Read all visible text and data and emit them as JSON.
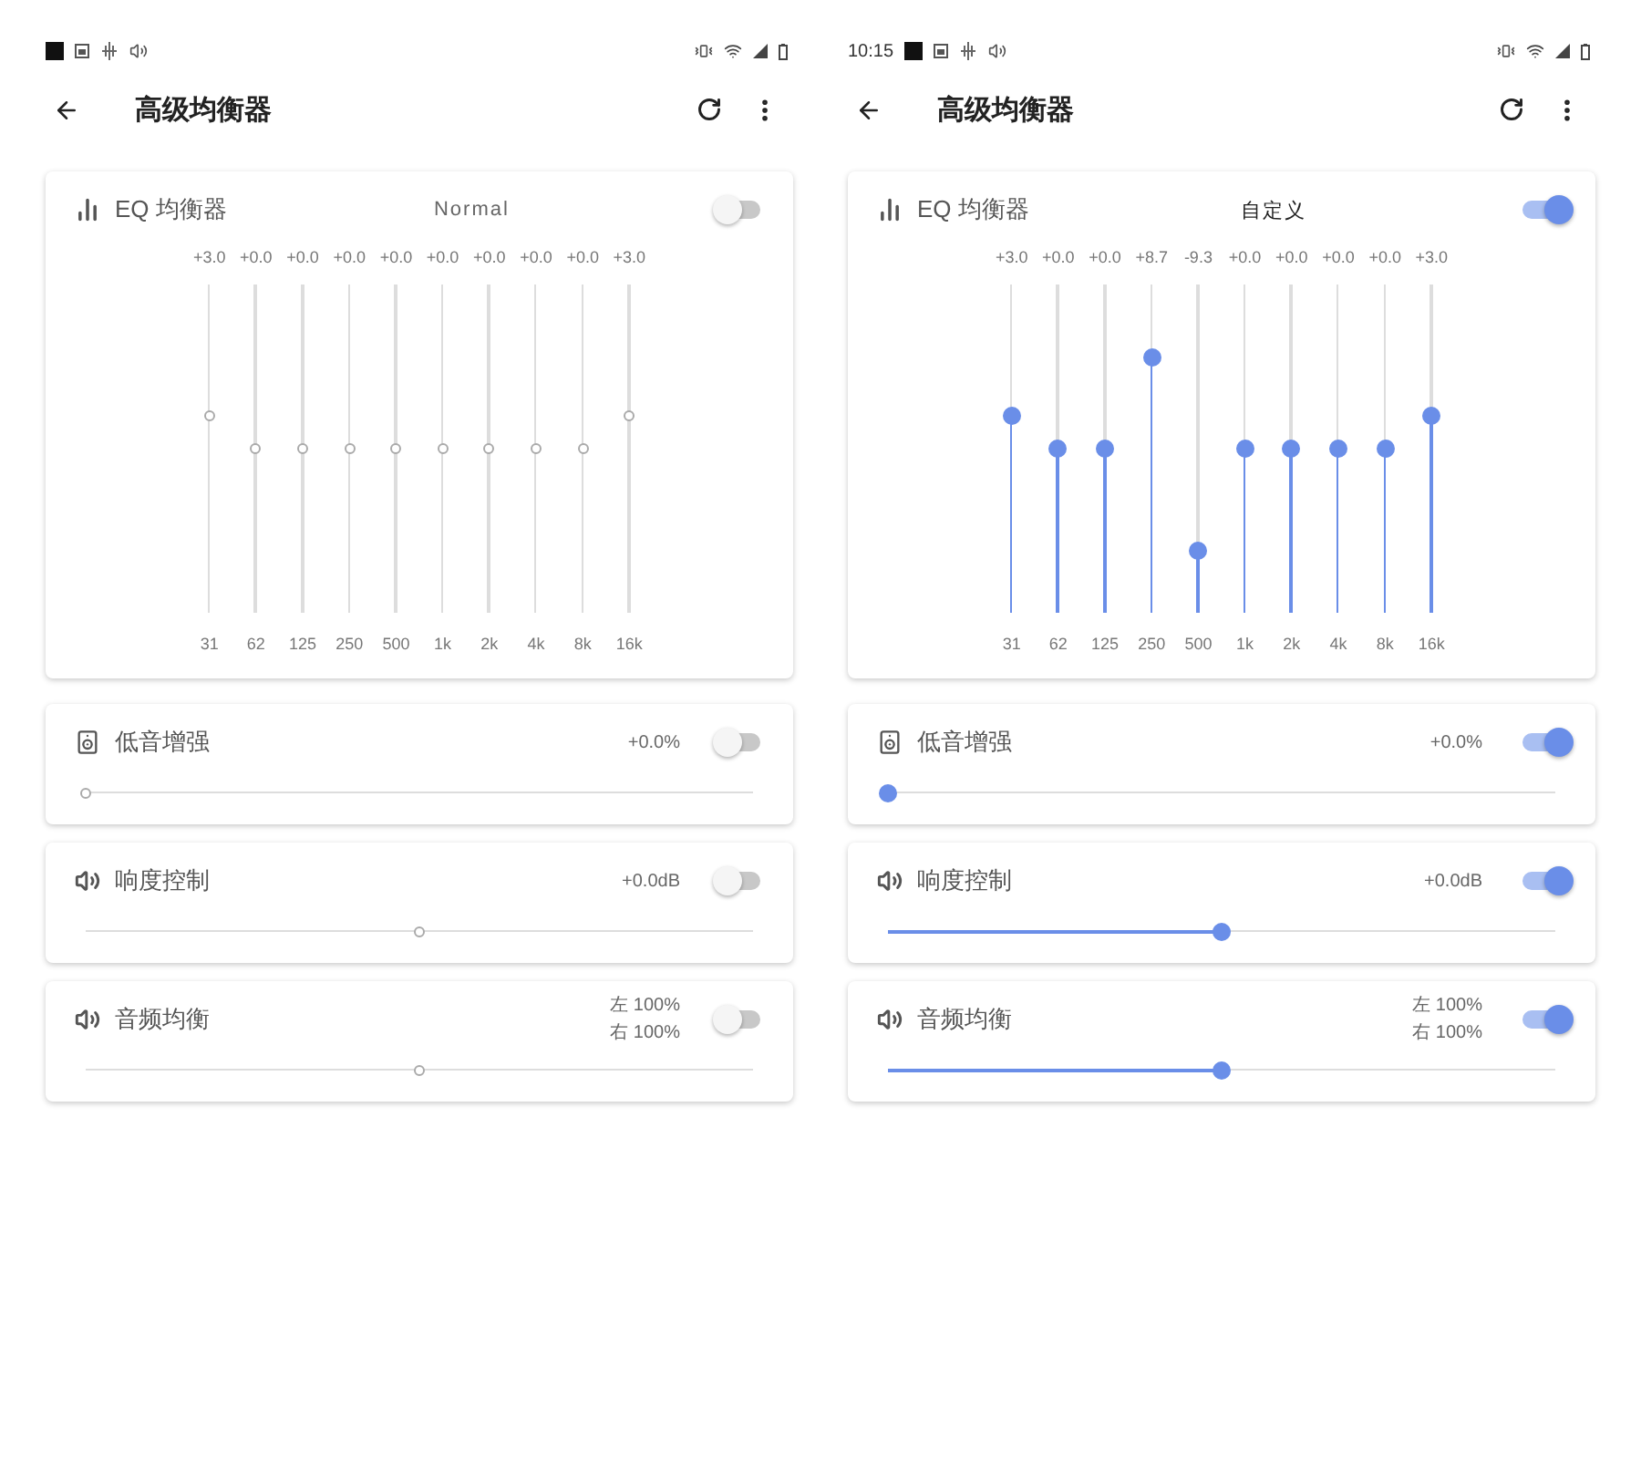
{
  "screens": [
    {
      "toolbar": {
        "title": "高级均衡器"
      },
      "eq": {
        "title": "EQ 均衡器",
        "preset": "Normal",
        "on": false,
        "bands": [
          {
            "gain": "+3.0",
            "freq": "31",
            "level": 0.6
          },
          {
            "gain": "+0.0",
            "freq": "62",
            "level": 0.5
          },
          {
            "gain": "+0.0",
            "freq": "125",
            "level": 0.5
          },
          {
            "gain": "+0.0",
            "freq": "250",
            "level": 0.5
          },
          {
            "gain": "+0.0",
            "freq": "500",
            "level": 0.5
          },
          {
            "gain": "+0.0",
            "freq": "1k",
            "level": 0.5
          },
          {
            "gain": "+0.0",
            "freq": "2k",
            "level": 0.5
          },
          {
            "gain": "+0.0",
            "freq": "4k",
            "level": 0.5
          },
          {
            "gain": "+0.0",
            "freq": "8k",
            "level": 0.5
          },
          {
            "gain": "+3.0",
            "freq": "16k",
            "level": 0.6
          }
        ]
      },
      "effects": [
        {
          "kind": "bass",
          "title": "低音增强",
          "readings": [
            "+0.0%"
          ],
          "on": false,
          "level": 0
        },
        {
          "kind": "loudness",
          "title": "响度控制",
          "readings": [
            "+0.0dB"
          ],
          "on": false,
          "level": 0.5
        },
        {
          "kind": "balance",
          "title": "音频均衡",
          "readings": [
            "左 100%",
            "右 100%"
          ],
          "on": false,
          "level": 0.5
        }
      ]
    },
    {
      "status_bar": {
        "time": "10:15"
      },
      "toolbar": {
        "title": "高级均衡器"
      },
      "eq": {
        "title": "EQ 均衡器",
        "preset": "自定义",
        "on": true,
        "bands": [
          {
            "gain": "+3.0",
            "freq": "31",
            "level": 0.6
          },
          {
            "gain": "+0.0",
            "freq": "62",
            "level": 0.5
          },
          {
            "gain": "+0.0",
            "freq": "125",
            "level": 0.5
          },
          {
            "gain": "+8.7",
            "freq": "250",
            "level": 0.78
          },
          {
            "gain": "-9.3",
            "freq": "500",
            "level": 0.19
          },
          {
            "gain": "+0.0",
            "freq": "1k",
            "level": 0.5
          },
          {
            "gain": "+0.0",
            "freq": "2k",
            "level": 0.5
          },
          {
            "gain": "+0.0",
            "freq": "4k",
            "level": 0.5
          },
          {
            "gain": "+0.0",
            "freq": "8k",
            "level": 0.5
          },
          {
            "gain": "+3.0",
            "freq": "16k",
            "level": 0.6
          }
        ]
      },
      "effects": [
        {
          "kind": "bass",
          "title": "低音增强",
          "readings": [
            "+0.0%"
          ],
          "on": true,
          "level": 0
        },
        {
          "kind": "loudness",
          "title": "响度控制",
          "readings": [
            "+0.0dB"
          ],
          "on": true,
          "level": 0.5
        },
        {
          "kind": "balance",
          "title": "音频均衡",
          "readings": [
            "左 100%",
            "右 100%"
          ],
          "on": true,
          "level": 0.5
        }
      ]
    }
  ]
}
